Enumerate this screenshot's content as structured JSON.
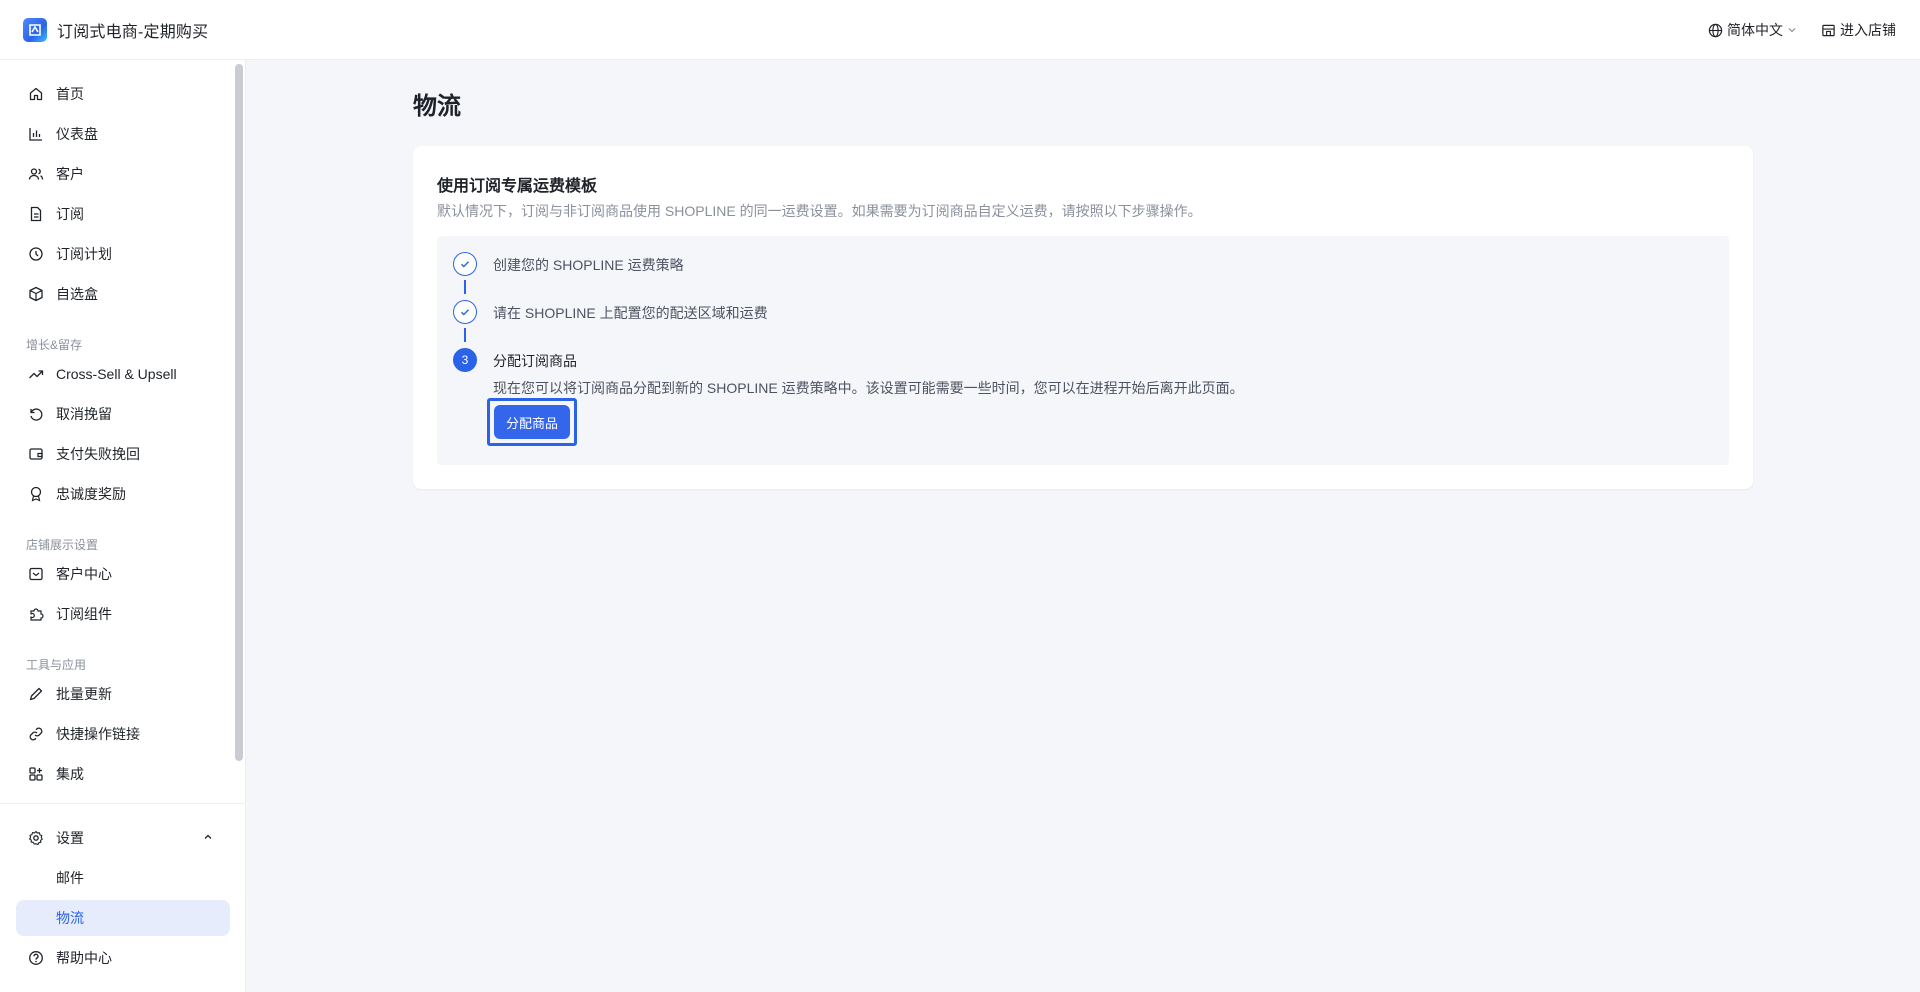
{
  "header": {
    "app_title": "订阅式电商-定期购买",
    "language_label": "简体中文",
    "enter_store_label": "进入店铺"
  },
  "sidebar": {
    "main_items": [
      {
        "label": "首页",
        "icon": "home-icon"
      },
      {
        "label": "仪表盘",
        "icon": "bar-chart-icon"
      },
      {
        "label": "客户",
        "icon": "users-icon"
      },
      {
        "label": "订阅",
        "icon": "document-icon"
      },
      {
        "label": "订阅计划",
        "icon": "plan-icon"
      },
      {
        "label": "自选盒",
        "icon": "box-icon"
      }
    ],
    "group_growth": "增长&留存",
    "growth_items": [
      {
        "label": "Cross-Sell & Upsell",
        "icon": "trend-up-icon"
      },
      {
        "label": "取消挽留",
        "icon": "undo-icon"
      },
      {
        "label": "支付失败挽回",
        "icon": "wallet-icon"
      },
      {
        "label": "忠诚度奖励",
        "icon": "medal-icon"
      }
    ],
    "group_store": "店铺展示设置",
    "store_items": [
      {
        "label": "客户中心",
        "icon": "inbox-icon"
      },
      {
        "label": "订阅组件",
        "icon": "puzzle-icon"
      }
    ],
    "group_tools": "工具与应用",
    "tools_items": [
      {
        "label": "批量更新",
        "icon": "pencil-icon"
      },
      {
        "label": "快捷操作链接",
        "icon": "link-icon"
      },
      {
        "label": "集成",
        "icon": "apps-icon"
      }
    ],
    "settings_label": "设置",
    "settings_sub": [
      {
        "label": "邮件"
      },
      {
        "label": "物流"
      }
    ],
    "help_label": "帮助中心"
  },
  "main": {
    "page_title": "物流",
    "card_title": "使用订阅专属运费模板",
    "card_desc": "默认情况下，订阅与非订阅商品使用 SHOPLINE 的同一运费设置。如果需要为订阅商品自定义运费，请按照以下步骤操作。",
    "steps": [
      {
        "text": "创建您的 SHOPLINE 运费策略",
        "status": "done"
      },
      {
        "text": "请在 SHOPLINE 上配置您的配送区域和运费",
        "status": "done"
      },
      {
        "text": "分配订阅商品",
        "status": "current",
        "number": "3",
        "detail": "现在您可以将订阅商品分配到新的 SHOPLINE 运费策略中。该设置可能需要一些时间，您可以在进程开始后离开此页面。",
        "button_label": "分配商品"
      }
    ]
  },
  "colors": {
    "accent": "#2b63e8",
    "active_bg": "#e6ecfb",
    "page_bg": "#f5f6f9"
  }
}
